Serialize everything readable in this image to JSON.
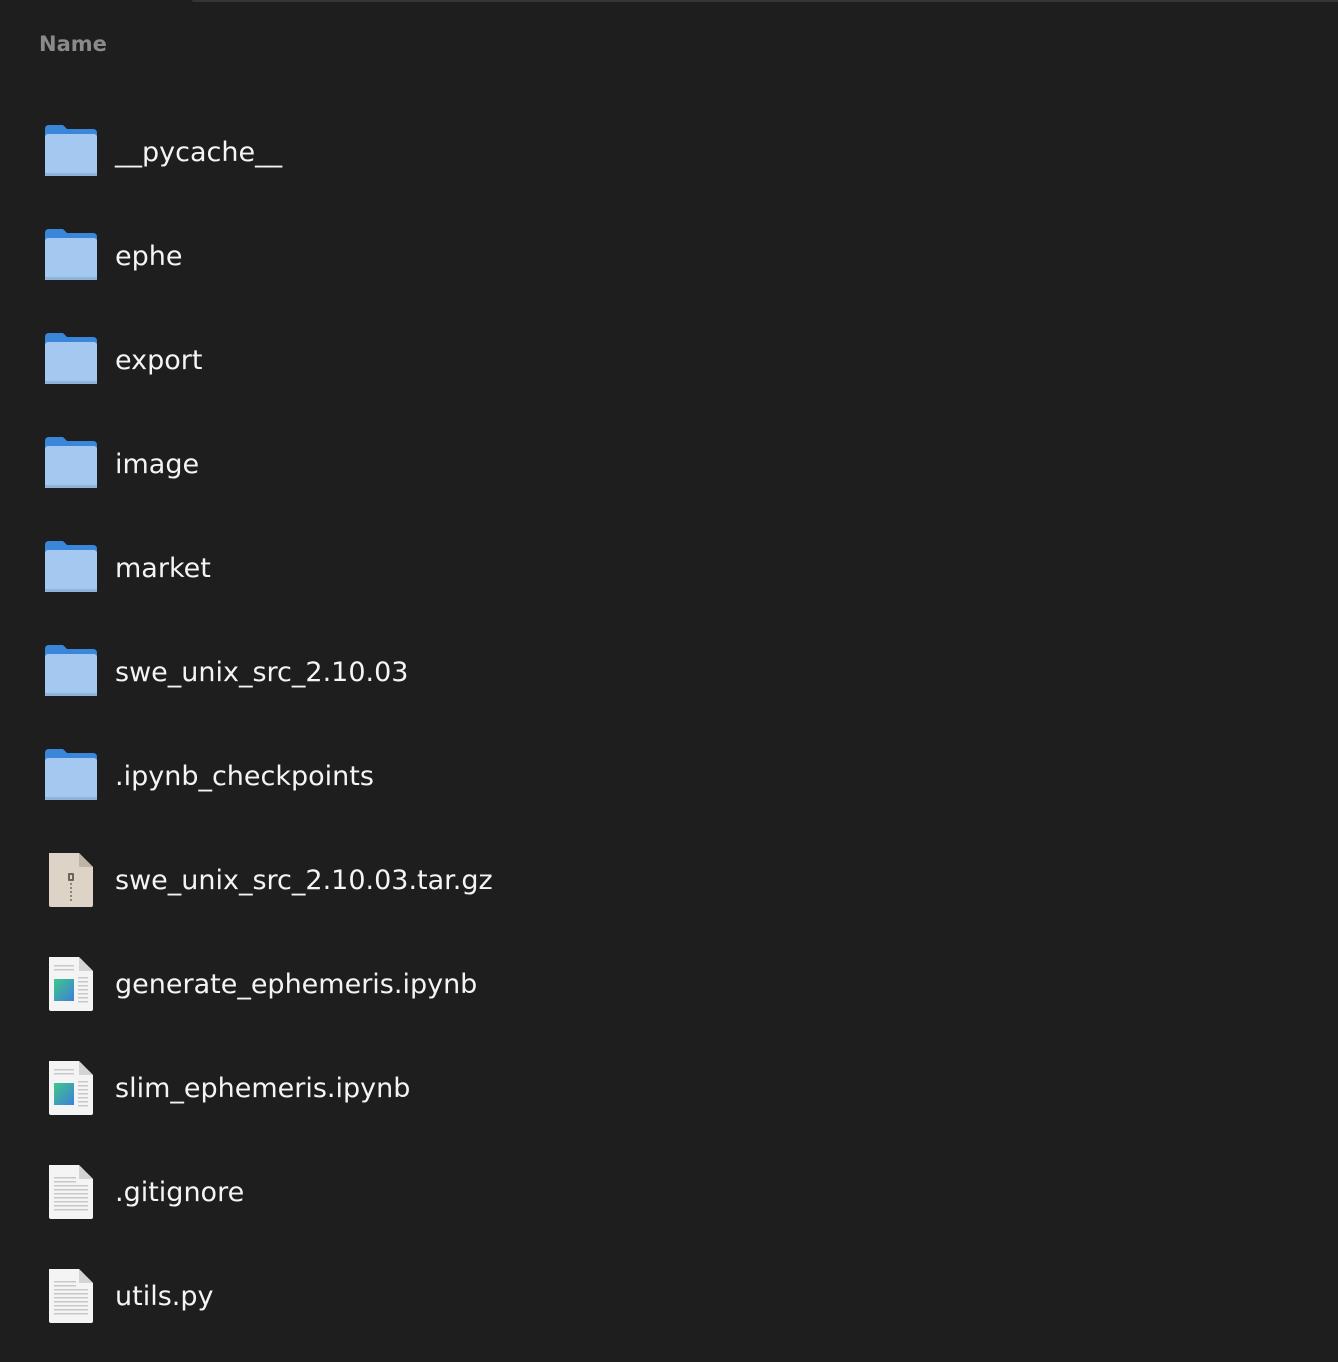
{
  "header": {
    "name_column": "Name"
  },
  "files": [
    {
      "name": "__pycache__",
      "type": "folder",
      "icon": "folder-icon"
    },
    {
      "name": "ephe",
      "type": "folder",
      "icon": "folder-icon"
    },
    {
      "name": "export",
      "type": "folder",
      "icon": "folder-icon"
    },
    {
      "name": "image",
      "type": "folder",
      "icon": "folder-icon"
    },
    {
      "name": "market",
      "type": "folder",
      "icon": "folder-icon"
    },
    {
      "name": "swe_unix_src_2.10.03",
      "type": "folder",
      "icon": "folder-icon"
    },
    {
      "name": ".ipynb_checkpoints",
      "type": "folder",
      "icon": "folder-icon"
    },
    {
      "name": "swe_unix_src_2.10.03.tar.gz",
      "type": "archive",
      "icon": "archive-icon"
    },
    {
      "name": "generate_ephemeris.ipynb",
      "type": "notebook",
      "icon": "notebook-file-icon"
    },
    {
      "name": "slim_ephemeris.ipynb",
      "type": "notebook",
      "icon": "notebook-file-icon"
    },
    {
      "name": ".gitignore",
      "type": "text",
      "icon": "text-file-icon"
    },
    {
      "name": "utils.py",
      "type": "text",
      "icon": "text-file-icon"
    }
  ],
  "colors": {
    "background": "#1e1e1e",
    "folder_front": "#a4c8f0",
    "folder_back": "#3a86d8",
    "header_text": "#8a8a8a"
  }
}
